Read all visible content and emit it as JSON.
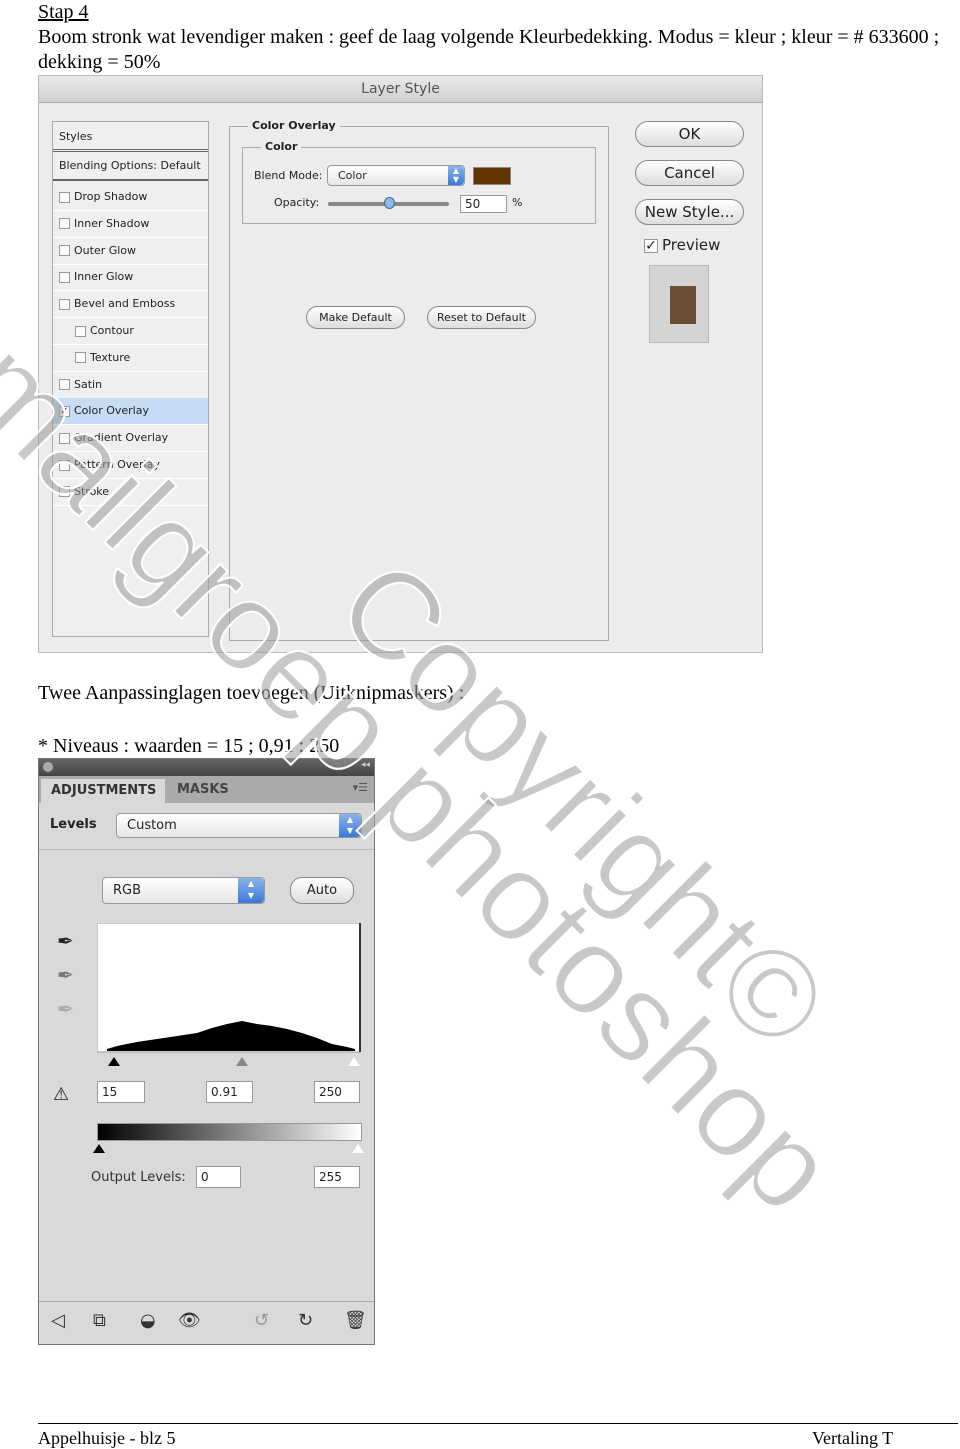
{
  "heading": "Stap 4",
  "intro": "Boom stronk wat levendiger maken : geef de laag volgende Kleurbedekking. Modus = kleur ; kleur = # 633600 ; dekking = 50%",
  "layer_style": {
    "title": "Layer Style",
    "styles_header": "Styles",
    "blending": "Blending Options: Default",
    "items": [
      {
        "label": "Drop Shadow",
        "checked": false
      },
      {
        "label": "Inner Shadow",
        "checked": false
      },
      {
        "label": "Outer Glow",
        "checked": false
      },
      {
        "label": "Inner Glow",
        "checked": false
      },
      {
        "label": "Bevel and Emboss",
        "checked": false
      },
      {
        "label": "Contour",
        "checked": false
      },
      {
        "label": "Texture",
        "checked": false
      },
      {
        "label": "Satin",
        "checked": false
      },
      {
        "label": "Color Overlay",
        "checked": true
      },
      {
        "label": "Gradient Overlay",
        "checked": false
      },
      {
        "label": "Pattern Overlay",
        "checked": false
      },
      {
        "label": "Stroke",
        "checked": false
      }
    ],
    "group_title": "Color Overlay",
    "subgroup_title": "Color",
    "blend_label": "Blend Mode:",
    "blend_value": "Color",
    "swatch_color": "#633600",
    "opacity_label": "Opacity:",
    "opacity_value": "50",
    "opacity_unit": "%",
    "make_default": "Make Default",
    "reset_default": "Reset to Default",
    "ok": "OK",
    "cancel": "Cancel",
    "new_style": "New Style...",
    "preview": "Preview",
    "preview_checked": true,
    "preview_color": "#6b4f34"
  },
  "text2": "Twee Aanpassinglagen toevoegen (Uitknipmaskers) :",
  "text3": "* Niveaus : waarden = 15 ;  0,91 ; 250",
  "adjustments": {
    "tab_adjust": "ADJUSTMENTS",
    "tab_masks": "MASKS",
    "levels_label": "Levels",
    "preset": "Custom",
    "channel": "RGB",
    "auto": "Auto",
    "input_black": "15",
    "input_gamma": "0.91",
    "input_white": "250",
    "output_label": "Output Levels:",
    "output_black": "0",
    "output_white": "255"
  },
  "footer": {
    "left": "Appelhuisje - blz 5",
    "right": "Vertaling T"
  },
  "watermark": {
    "line1": "Copyright©",
    "line2": "mailgroep photoshop"
  }
}
